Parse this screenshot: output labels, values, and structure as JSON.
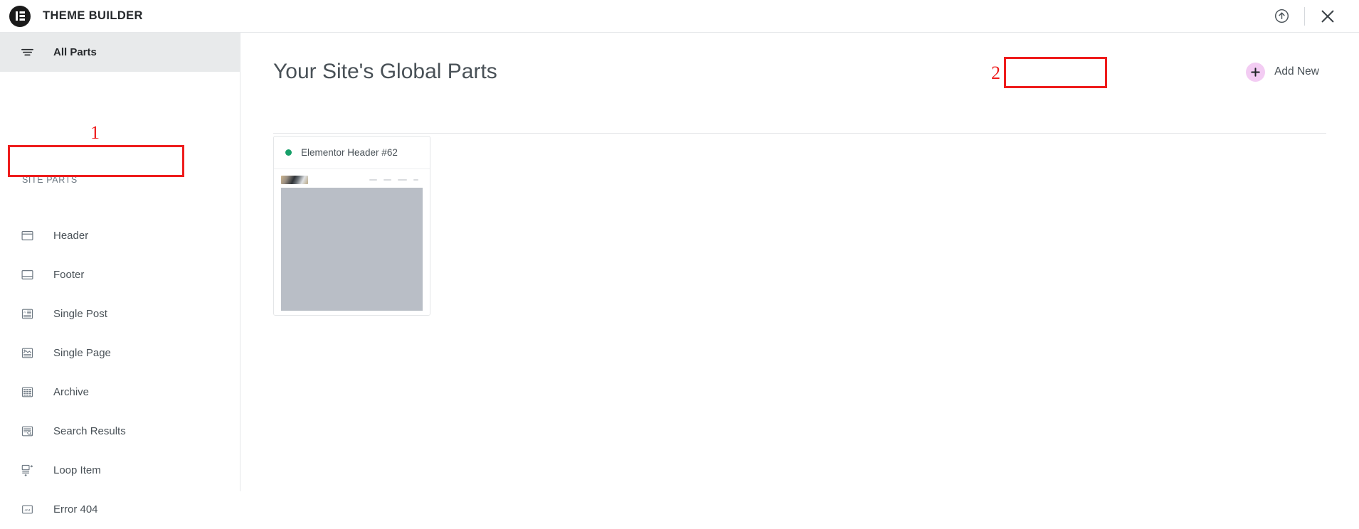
{
  "topbar": {
    "brand_title": "THEME BUILDER",
    "logo_icon": "elementor-logo-icon",
    "actions": [
      {
        "name": "upload-circle-icon",
        "label": ""
      },
      {
        "name": "close-icon",
        "label": ""
      }
    ]
  },
  "sidebar": {
    "all_parts": {
      "label": "All Parts",
      "icon": "filter-icon"
    },
    "section_label": "SITE PARTS",
    "items": [
      {
        "label": "Header",
        "icon": "header-layout-icon"
      },
      {
        "label": "Footer",
        "icon": "footer-layout-icon"
      },
      {
        "label": "Single Post",
        "icon": "single-post-icon"
      },
      {
        "label": "Single Page",
        "icon": "single-page-icon"
      },
      {
        "label": "Archive",
        "icon": "archive-grid-icon"
      },
      {
        "label": "Search Results",
        "icon": "search-results-icon"
      },
      {
        "label": "Loop Item",
        "icon": "loop-item-icon"
      },
      {
        "label": "Error 404",
        "icon": "error-404-icon"
      }
    ]
  },
  "main": {
    "page_title": "Your Site's Global Parts",
    "add_new": {
      "label": "Add New",
      "icon": "plus-icon"
    },
    "cards": [
      {
        "title": "Elementor Header #62",
        "status": "published",
        "status_color": "#18a06a"
      }
    ]
  },
  "annotations": [
    {
      "number": "1",
      "target": "sidebar-item-header"
    },
    {
      "number": "2",
      "target": "add-new-button"
    }
  ],
  "colors": {
    "accent_pink": "#f3ccf3",
    "annotation_red": "#ee1c1c",
    "status_green": "#18a06a",
    "sidebar_active_bg": "#e8eaeb",
    "text_primary": "#26292c",
    "text_secondary": "#495157"
  }
}
